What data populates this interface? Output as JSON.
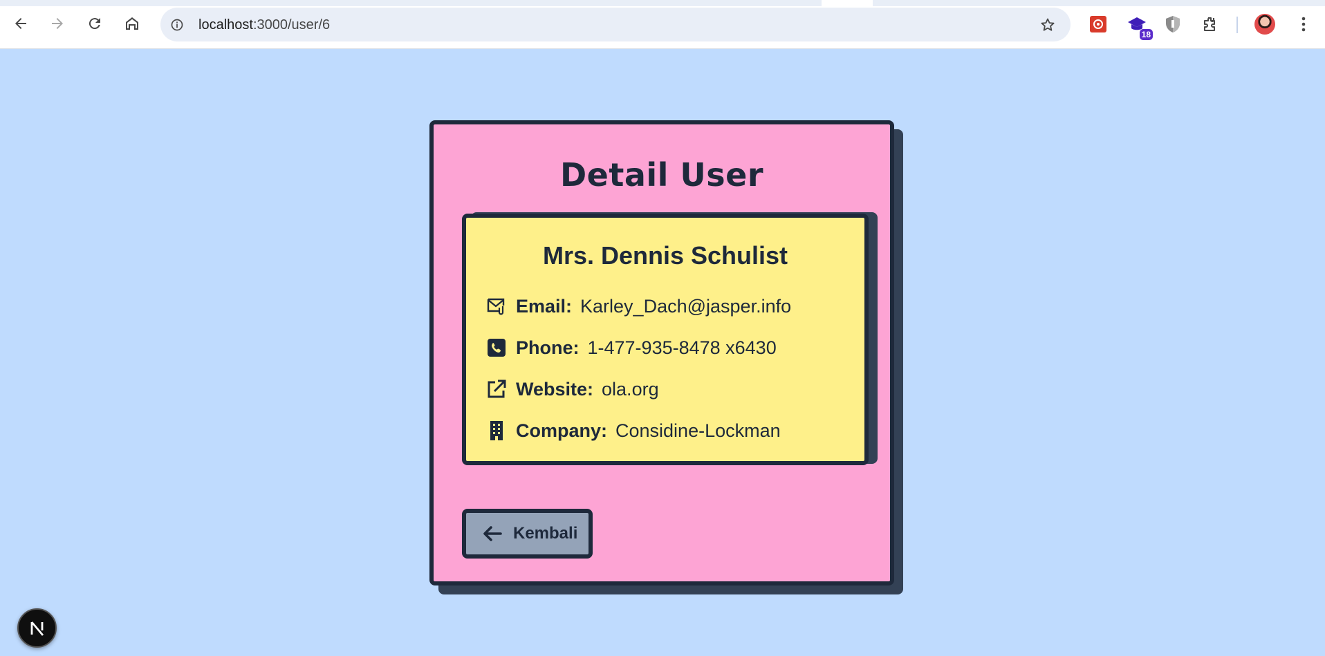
{
  "browser": {
    "url_host": "localhost",
    "url_path": ":3000/user/6",
    "extension_badge": "18"
  },
  "page": {
    "title": "Detail User",
    "user": {
      "name": "Mrs. Dennis Schulist",
      "fields": [
        {
          "label": "Email:",
          "value": "Karley_Dach@jasper.info",
          "icon": "mail-icon"
        },
        {
          "label": "Phone:",
          "value": "1-477-935-8478 x6430",
          "icon": "phone-icon"
        },
        {
          "label": "Website:",
          "value": "ola.org",
          "icon": "external-link-icon"
        },
        {
          "label": "Company:",
          "value": "Considine-Lockman",
          "icon": "building-icon"
        }
      ]
    },
    "back_button": "Kembali"
  },
  "devtools": {
    "badge_letter": "N"
  },
  "colors": {
    "background": "#bfdbfe",
    "card": "#fda4d4",
    "inner_card": "#fef08a",
    "button": "#94a3b8",
    "ink": "#1e293b"
  }
}
